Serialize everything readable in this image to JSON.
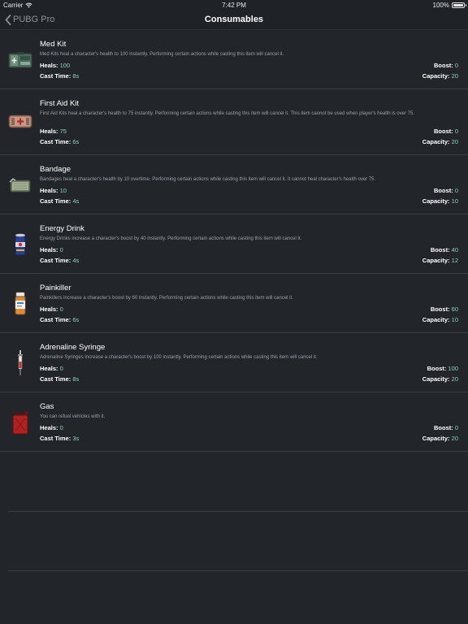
{
  "status_bar": {
    "carrier": "Carrier",
    "time": "7:42 PM",
    "battery": "100%"
  },
  "nav": {
    "back_label": "PUBG Pro",
    "title": "Consumables"
  },
  "labels": {
    "heals": "Heals:",
    "cast_time": "Cast Time:",
    "boost": "Boost:",
    "capacity": "Capacity:"
  },
  "items": [
    {
      "name": "Med Kit",
      "icon": "med-kit-icon",
      "description": "Med Kits heal a character's health to 100 instantly. Performing certain actions while casting this item will cancel it.",
      "heals": "100",
      "cast_time": "8s",
      "boost": "0",
      "capacity": "20"
    },
    {
      "name": "First Aid Kit",
      "icon": "first-aid-kit-icon",
      "description": "First Aid Kits heal a character's health to 75 instantly. Performing certain actions while casting this item will cancel it. This item cannot be used when player's health is over 75.",
      "heals": "75",
      "cast_time": "6s",
      "boost": "0",
      "capacity": "20"
    },
    {
      "name": "Bandage",
      "icon": "bandage-icon",
      "description": "Bandages heal a character's health by 10 overtime. Performing certain actions while casting this item will cancel it. It cannot heal character's health over 75.",
      "heals": "10",
      "cast_time": "4s",
      "boost": "0",
      "capacity": "10"
    },
    {
      "name": "Energy Drink",
      "icon": "energy-drink-icon",
      "description": "Energy Drinks increase a character's boost by 40 instantly. Performing certain actions while casting this item will cancel it.",
      "heals": "0",
      "cast_time": "4s",
      "boost": "40",
      "capacity": "12"
    },
    {
      "name": "Painkiller",
      "icon": "painkiller-icon",
      "description": "Painkillers increase a character's boost by 60 instantly. Performing certain actions while casting this item will cancel it.",
      "heals": "0",
      "cast_time": "6s",
      "boost": "60",
      "capacity": "10"
    },
    {
      "name": "Adrenaline Syringe",
      "icon": "syringe-icon",
      "description": "Adrenaline Syringes increase a character's boost by 100 instantly. Performing certain actions while casting this item will cancel it.",
      "heals": "0",
      "cast_time": "8s",
      "boost": "100",
      "capacity": "20"
    },
    {
      "name": "Gas",
      "icon": "gas-can-icon",
      "description": "You can refuel vehicles with it.",
      "heals": "0",
      "cast_time": "3s",
      "boost": "0",
      "capacity": "20"
    }
  ],
  "colors": {
    "background": "#22262b",
    "bar": "#1f2328",
    "value": "#8ed3b8",
    "separator": "#3a3f45"
  }
}
